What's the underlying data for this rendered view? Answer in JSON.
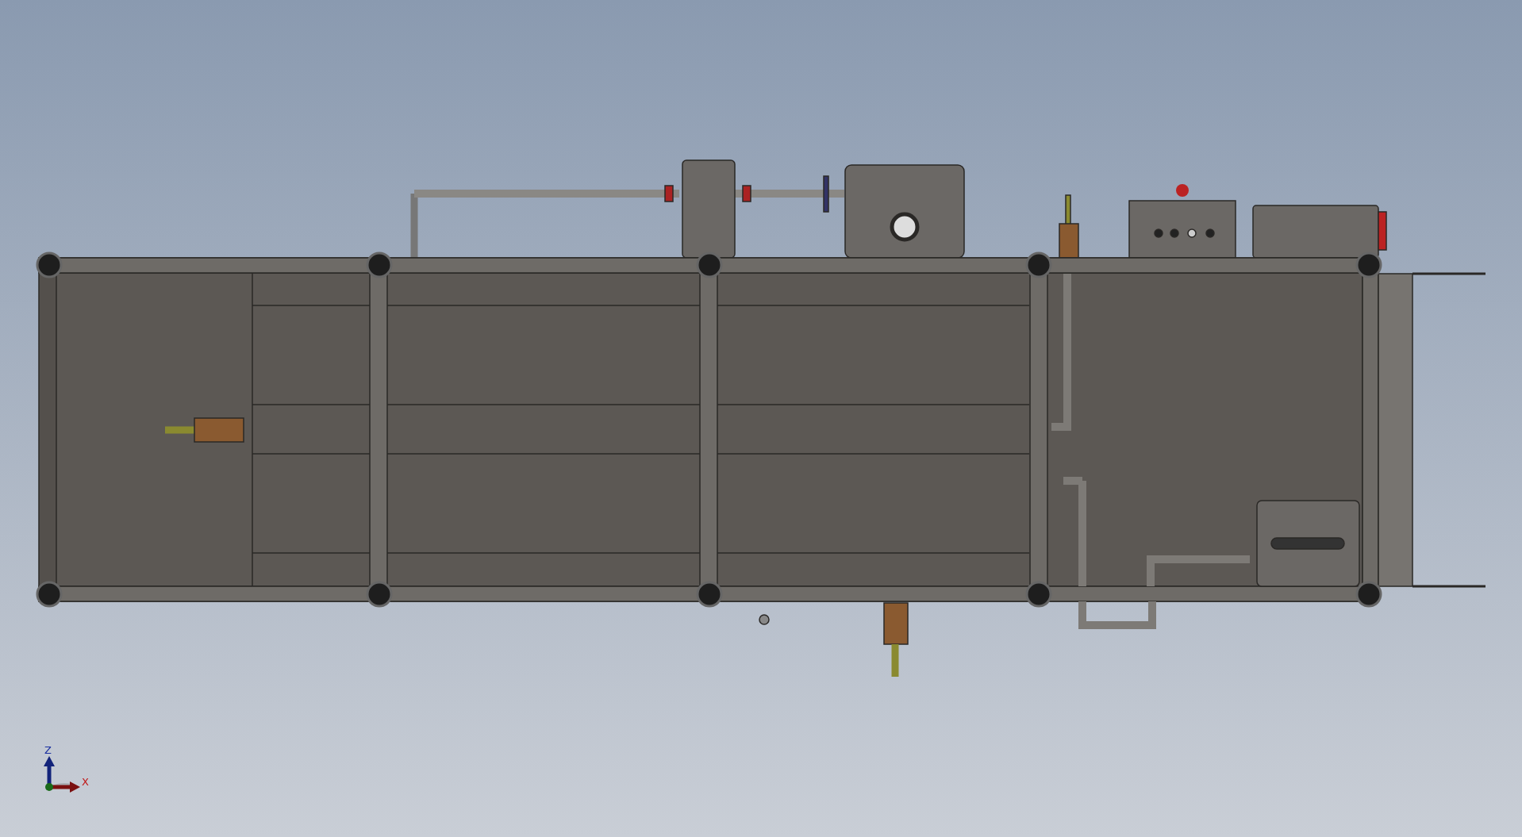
{
  "viewport": {
    "triad": {
      "axes": [
        {
          "kind": "z",
          "label": "Z"
        },
        {
          "kind": "x",
          "label": "X"
        }
      ]
    }
  }
}
